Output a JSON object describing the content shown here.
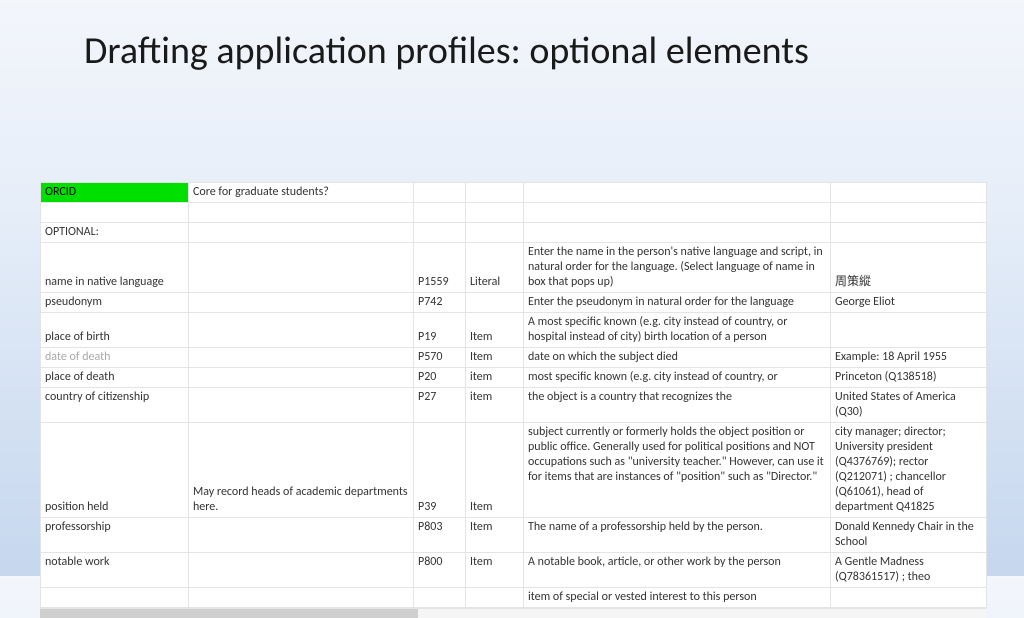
{
  "slide": {
    "title": "Drafting application profiles: optional elements"
  },
  "table": {
    "row_orcid": {
      "a": "ORCID",
      "b": "Core for graduate students?",
      "c": "",
      "d": "",
      "e": "",
      "f": ""
    },
    "row_blank": {
      "a": "",
      "b": "",
      "c": "",
      "d": "",
      "e": "",
      "f": ""
    },
    "row_optional": {
      "a": "OPTIONAL:",
      "b": "",
      "c": "",
      "d": "",
      "e": "",
      "f": ""
    },
    "row_nativename": {
      "a": "name in native language",
      "b": "",
      "c": "P1559",
      "d": "Literal",
      "e": "Enter the name in the person's native language and script, in natural order for the language. (Select language of name in box that pops up)",
      "f": "周策縱"
    },
    "row_pseudonym": {
      "a": "pseudonym",
      "b": "",
      "c": "P742",
      "d": "",
      "e": "Enter the pseudonym in natural order for the language",
      "f": "George Eliot"
    },
    "row_birth": {
      "a": "place of birth",
      "b": "",
      "c": "P19",
      "d": "Item",
      "e": "A most specific known (e.g. city instead of country, or hospital instead of city) birth location of a person",
      "f": ""
    },
    "row_dod": {
      "a": "date of death",
      "b": "",
      "c": "P570",
      "d": "Item",
      "e": "date on which the subject died",
      "f": "Example: 18 April 1955"
    },
    "row_death": {
      "a": "place of death",
      "b": "",
      "c": "P20",
      "d": "item",
      "e": "most specific known (e.g. city instead of country, or",
      "f": "Princeton (Q138518)"
    },
    "row_citizenship": {
      "a": "country of citizenship",
      "b": "",
      "c": "P27",
      "d": "item",
      "e": "the object is a country that recognizes the",
      "f": "United States of America (Q30)"
    },
    "row_position": {
      "a": "position held",
      "b": "May record heads of academic departments here.",
      "c": "P39",
      "d": "Item",
      "e": "subject currently or formerly holds the object position or public office.   Generally used for political positions and NOT occupations such as \"university teacher.\"  However, can use it for items that are instances of \"position\" such as \"Director.\"",
      "f": "city manager; director; University president (Q4376769); rector (Q212071) ; chancellor (Q61061), head of department Q41825"
    },
    "row_professorship": {
      "a": "professorship",
      "b": "",
      "c": "P803",
      "d": "Item",
      "e": "The name of a professorship held by the person.",
      "f": "Donald Kennedy Chair in the School"
    },
    "row_notablework": {
      "a": "notable work",
      "b": "",
      "c": "P800",
      "d": "Item",
      "e": "A notable book, article, or other work by the person",
      "f": "A Gentle Madness (Q78361517) ; theo"
    },
    "row_vested": {
      "a": "",
      "b": "",
      "c": "",
      "d": "",
      "e": "item of special or vested interest to this person",
      "f": ""
    }
  }
}
